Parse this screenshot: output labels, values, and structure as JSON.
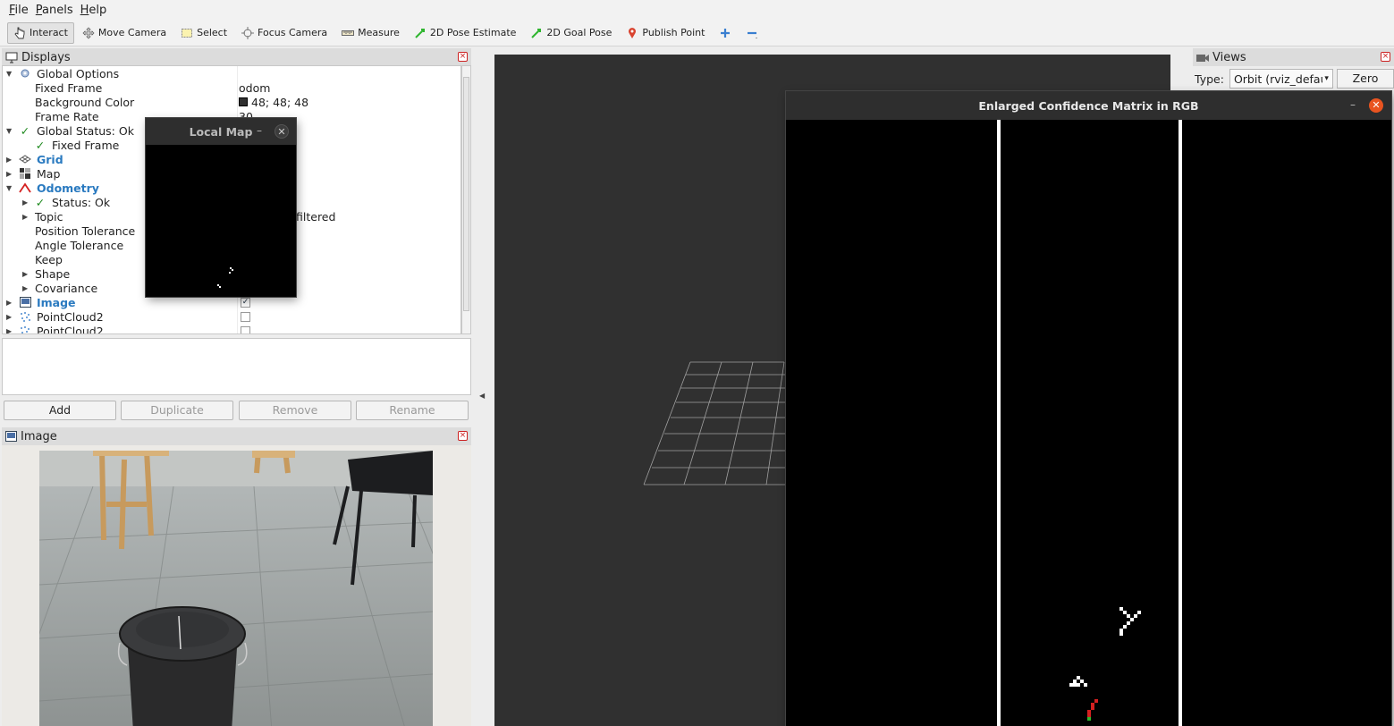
{
  "menu": [
    {
      "label": "File",
      "mnemonic": "F",
      "rest": "ile"
    },
    {
      "label": "Panels",
      "mnemonic": "P",
      "rest": "anels"
    },
    {
      "label": "Help",
      "mnemonic": "H",
      "rest": "elp"
    }
  ],
  "toolbar": {
    "interact": "Interact",
    "move_camera": "Move Camera",
    "select": "Select",
    "focus_camera": "Focus Camera",
    "measure": "Measure",
    "pose_estimate": "2D Pose Estimate",
    "goal_pose": "2D Goal Pose",
    "publish_point": "Publish Point"
  },
  "displays": {
    "title": "Displays",
    "rows": {
      "global_options": "Global Options",
      "fixed_frame": "Fixed Frame",
      "fixed_frame_value": "odom",
      "background_color": "Background Color",
      "background_color_value": "48; 48; 48",
      "frame_rate": "Frame Rate",
      "frame_rate_value": "30",
      "global_status": "Global Status: Ok",
      "fixed_frame_status": "Fixed Frame",
      "grid": "Grid",
      "map": "Map",
      "odometry": "Odometry",
      "status_ok": "Status: Ok",
      "topic": "Topic",
      "topic_value": "filtered",
      "position_tolerance": "Position Tolerance",
      "angle_tolerance": "Angle Tolerance",
      "keep": "Keep",
      "shape": "Shape",
      "covariance": "Covariance",
      "image": "Image",
      "pointcloud2_a": "PointCloud2",
      "pointcloud2_b": "PointCloud2"
    },
    "checkbox_image": true,
    "checkbox_pc_a": false,
    "checkbox_pc_b": false,
    "buttons": {
      "add": "Add",
      "duplicate": "Duplicate",
      "remove": "Remove",
      "rename": "Rename"
    }
  },
  "image_panel": {
    "title": "Image"
  },
  "views": {
    "title": "Views",
    "type_label": "Type:",
    "type_value": "Orbit (rviz_defau",
    "zero": "Zero"
  },
  "local_map": {
    "title": "Local Map",
    "close": "✕",
    "min": "–"
  },
  "confidence": {
    "title": "Enlarged Confidence Matrix in RGB",
    "close": "✕",
    "min": "–"
  },
  "colors": {
    "accent_blue": "#2a7ac0",
    "ok_green": "#1e8a1e",
    "viewport_bg": "#303030",
    "close_orange": "#e95420",
    "bg_color_swatch": "#303030",
    "marker_red": "#d42020"
  },
  "icons": {
    "interact": "hand-pointer-icon",
    "move_camera": "move-arrows-icon",
    "select": "select-rect-icon",
    "focus_camera": "crosshair-icon",
    "measure": "ruler-icon",
    "pose_estimate": "green-arrow-icon",
    "goal_pose": "green-arrow-icon",
    "publish_point": "map-pin-icon",
    "add_tool": "plus-icon",
    "remove_tool": "minus-icon"
  }
}
